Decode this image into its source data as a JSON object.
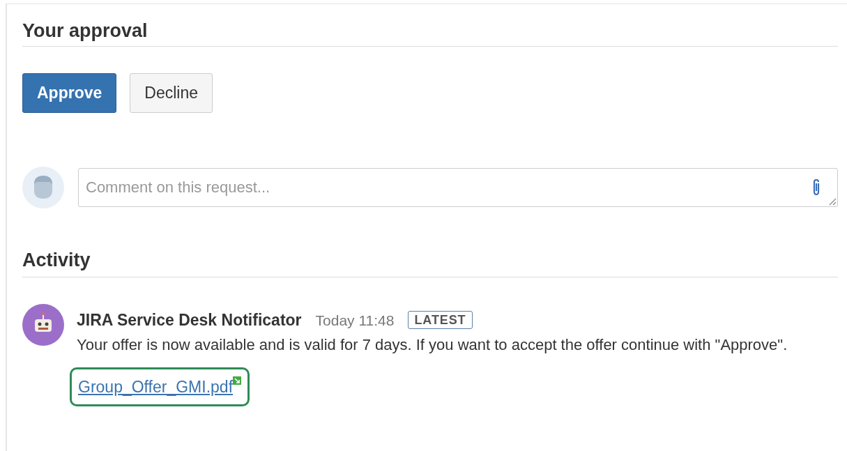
{
  "approval": {
    "title": "Your approval",
    "buttons": [
      {
        "label": "Approve",
        "kind": "primary"
      },
      {
        "label": "Decline",
        "kind": "default"
      }
    ]
  },
  "comment": {
    "placeholder": "Comment on this request..."
  },
  "activity": {
    "title": "Activity",
    "items": [
      {
        "author": "JIRA Service Desk Notificator",
        "time": "Today 11:48",
        "badge": "LATEST",
        "message": "Your offer is now available and is valid for 7 days. If you want to accept the offer continue with \"Approve\".",
        "attachment": "Group_Offer_GMI.pdf",
        "highlighted": true
      }
    ]
  }
}
